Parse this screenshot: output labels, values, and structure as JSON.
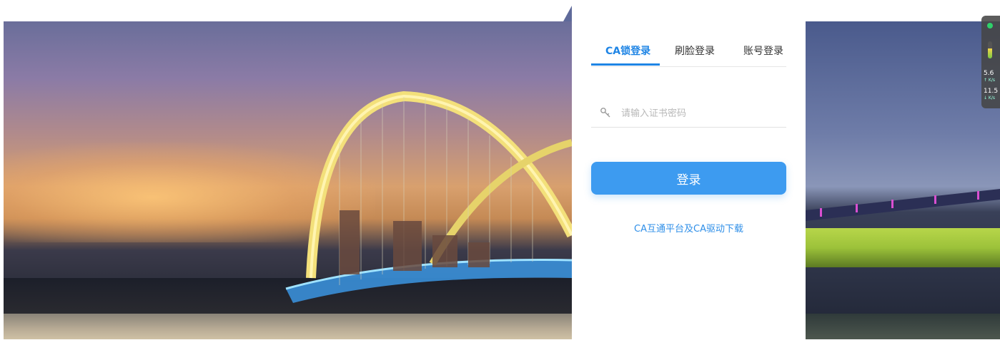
{
  "login": {
    "tabs": [
      {
        "label": "CA锁登录",
        "active": true
      },
      {
        "label": "刷脸登录",
        "active": false
      },
      {
        "label": "账号登录",
        "active": false
      }
    ],
    "password_placeholder": "请输入证书密码",
    "submit_label": "登录",
    "download_link": "CA互通平台及CA驱动下载"
  },
  "network_widget": {
    "upload_value": "5.6",
    "upload_unit": "↑ K/s",
    "download_value": "11.5",
    "download_unit": "↓ K/s",
    "status_color": "#2fd06a",
    "load_level": 0.6
  },
  "colors": {
    "accent": "#1f85e5",
    "button": "#3d9bf0"
  }
}
